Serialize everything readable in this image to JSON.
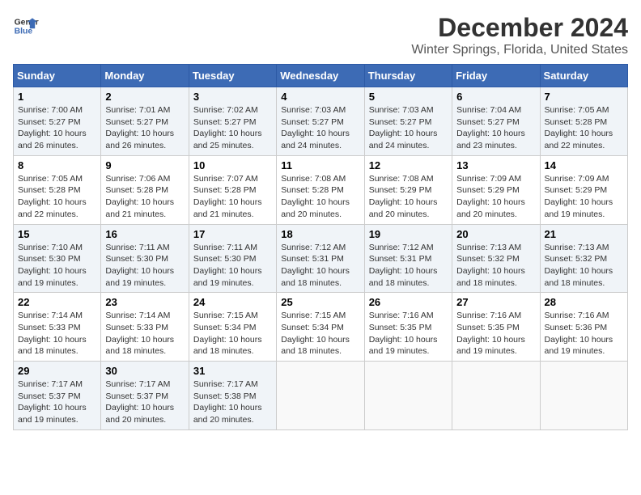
{
  "logo": {
    "line1": "General",
    "line2": "Blue"
  },
  "title": "December 2024",
  "subtitle": "Winter Springs, Florida, United States",
  "headers": [
    "Sunday",
    "Monday",
    "Tuesday",
    "Wednesday",
    "Thursday",
    "Friday",
    "Saturday"
  ],
  "weeks": [
    [
      {
        "day": "1",
        "sunrise": "7:00 AM",
        "sunset": "5:27 PM",
        "daylight": "10 hours and 26 minutes."
      },
      {
        "day": "2",
        "sunrise": "7:01 AM",
        "sunset": "5:27 PM",
        "daylight": "10 hours and 26 minutes."
      },
      {
        "day": "3",
        "sunrise": "7:02 AM",
        "sunset": "5:27 PM",
        "daylight": "10 hours and 25 minutes."
      },
      {
        "day": "4",
        "sunrise": "7:03 AM",
        "sunset": "5:27 PM",
        "daylight": "10 hours and 24 minutes."
      },
      {
        "day": "5",
        "sunrise": "7:03 AM",
        "sunset": "5:27 PM",
        "daylight": "10 hours and 24 minutes."
      },
      {
        "day": "6",
        "sunrise": "7:04 AM",
        "sunset": "5:27 PM",
        "daylight": "10 hours and 23 minutes."
      },
      {
        "day": "7",
        "sunrise": "7:05 AM",
        "sunset": "5:28 PM",
        "daylight": "10 hours and 22 minutes."
      }
    ],
    [
      {
        "day": "8",
        "sunrise": "7:05 AM",
        "sunset": "5:28 PM",
        "daylight": "10 hours and 22 minutes."
      },
      {
        "day": "9",
        "sunrise": "7:06 AM",
        "sunset": "5:28 PM",
        "daylight": "10 hours and 21 minutes."
      },
      {
        "day": "10",
        "sunrise": "7:07 AM",
        "sunset": "5:28 PM",
        "daylight": "10 hours and 21 minutes."
      },
      {
        "day": "11",
        "sunrise": "7:08 AM",
        "sunset": "5:28 PM",
        "daylight": "10 hours and 20 minutes."
      },
      {
        "day": "12",
        "sunrise": "7:08 AM",
        "sunset": "5:29 PM",
        "daylight": "10 hours and 20 minutes."
      },
      {
        "day": "13",
        "sunrise": "7:09 AM",
        "sunset": "5:29 PM",
        "daylight": "10 hours and 20 minutes."
      },
      {
        "day": "14",
        "sunrise": "7:09 AM",
        "sunset": "5:29 PM",
        "daylight": "10 hours and 19 minutes."
      }
    ],
    [
      {
        "day": "15",
        "sunrise": "7:10 AM",
        "sunset": "5:30 PM",
        "daylight": "10 hours and 19 minutes."
      },
      {
        "day": "16",
        "sunrise": "7:11 AM",
        "sunset": "5:30 PM",
        "daylight": "10 hours and 19 minutes."
      },
      {
        "day": "17",
        "sunrise": "7:11 AM",
        "sunset": "5:30 PM",
        "daylight": "10 hours and 19 minutes."
      },
      {
        "day": "18",
        "sunrise": "7:12 AM",
        "sunset": "5:31 PM",
        "daylight": "10 hours and 18 minutes."
      },
      {
        "day": "19",
        "sunrise": "7:12 AM",
        "sunset": "5:31 PM",
        "daylight": "10 hours and 18 minutes."
      },
      {
        "day": "20",
        "sunrise": "7:13 AM",
        "sunset": "5:32 PM",
        "daylight": "10 hours and 18 minutes."
      },
      {
        "day": "21",
        "sunrise": "7:13 AM",
        "sunset": "5:32 PM",
        "daylight": "10 hours and 18 minutes."
      }
    ],
    [
      {
        "day": "22",
        "sunrise": "7:14 AM",
        "sunset": "5:33 PM",
        "daylight": "10 hours and 18 minutes."
      },
      {
        "day": "23",
        "sunrise": "7:14 AM",
        "sunset": "5:33 PM",
        "daylight": "10 hours and 18 minutes."
      },
      {
        "day": "24",
        "sunrise": "7:15 AM",
        "sunset": "5:34 PM",
        "daylight": "10 hours and 18 minutes."
      },
      {
        "day": "25",
        "sunrise": "7:15 AM",
        "sunset": "5:34 PM",
        "daylight": "10 hours and 18 minutes."
      },
      {
        "day": "26",
        "sunrise": "7:16 AM",
        "sunset": "5:35 PM",
        "daylight": "10 hours and 19 minutes."
      },
      {
        "day": "27",
        "sunrise": "7:16 AM",
        "sunset": "5:35 PM",
        "daylight": "10 hours and 19 minutes."
      },
      {
        "day": "28",
        "sunrise": "7:16 AM",
        "sunset": "5:36 PM",
        "daylight": "10 hours and 19 minutes."
      }
    ],
    [
      {
        "day": "29",
        "sunrise": "7:17 AM",
        "sunset": "5:37 PM",
        "daylight": "10 hours and 19 minutes."
      },
      {
        "day": "30",
        "sunrise": "7:17 AM",
        "sunset": "5:37 PM",
        "daylight": "10 hours and 20 minutes."
      },
      {
        "day": "31",
        "sunrise": "7:17 AM",
        "sunset": "5:38 PM",
        "daylight": "10 hours and 20 minutes."
      },
      null,
      null,
      null,
      null
    ]
  ],
  "labels": {
    "sunrise": "Sunrise:",
    "sunset": "Sunset:",
    "daylight": "Daylight:"
  }
}
